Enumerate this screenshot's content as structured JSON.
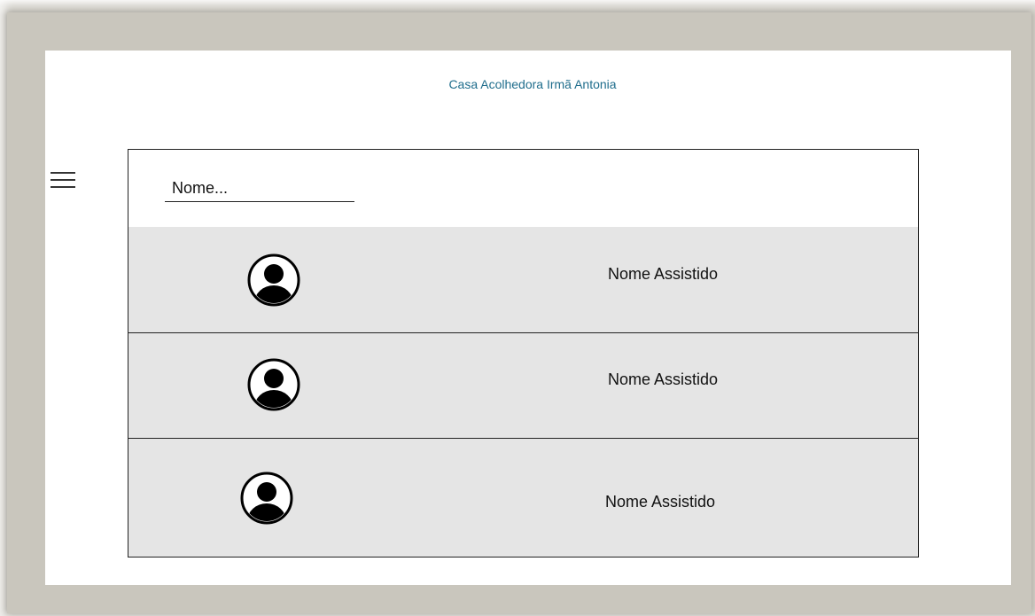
{
  "header": {
    "title": "Casa Acolhedora Irmã Antonia"
  },
  "menu": {
    "icon": "hamburger-menu-icon"
  },
  "search": {
    "placeholder": "Nome..."
  },
  "list": {
    "items": [
      {
        "name": "Nome Assistido",
        "icon": "user-avatar-icon"
      },
      {
        "name": "Nome Assistido",
        "icon": "user-avatar-icon"
      },
      {
        "name": "Nome Assistido",
        "icon": "user-avatar-icon"
      }
    ]
  }
}
